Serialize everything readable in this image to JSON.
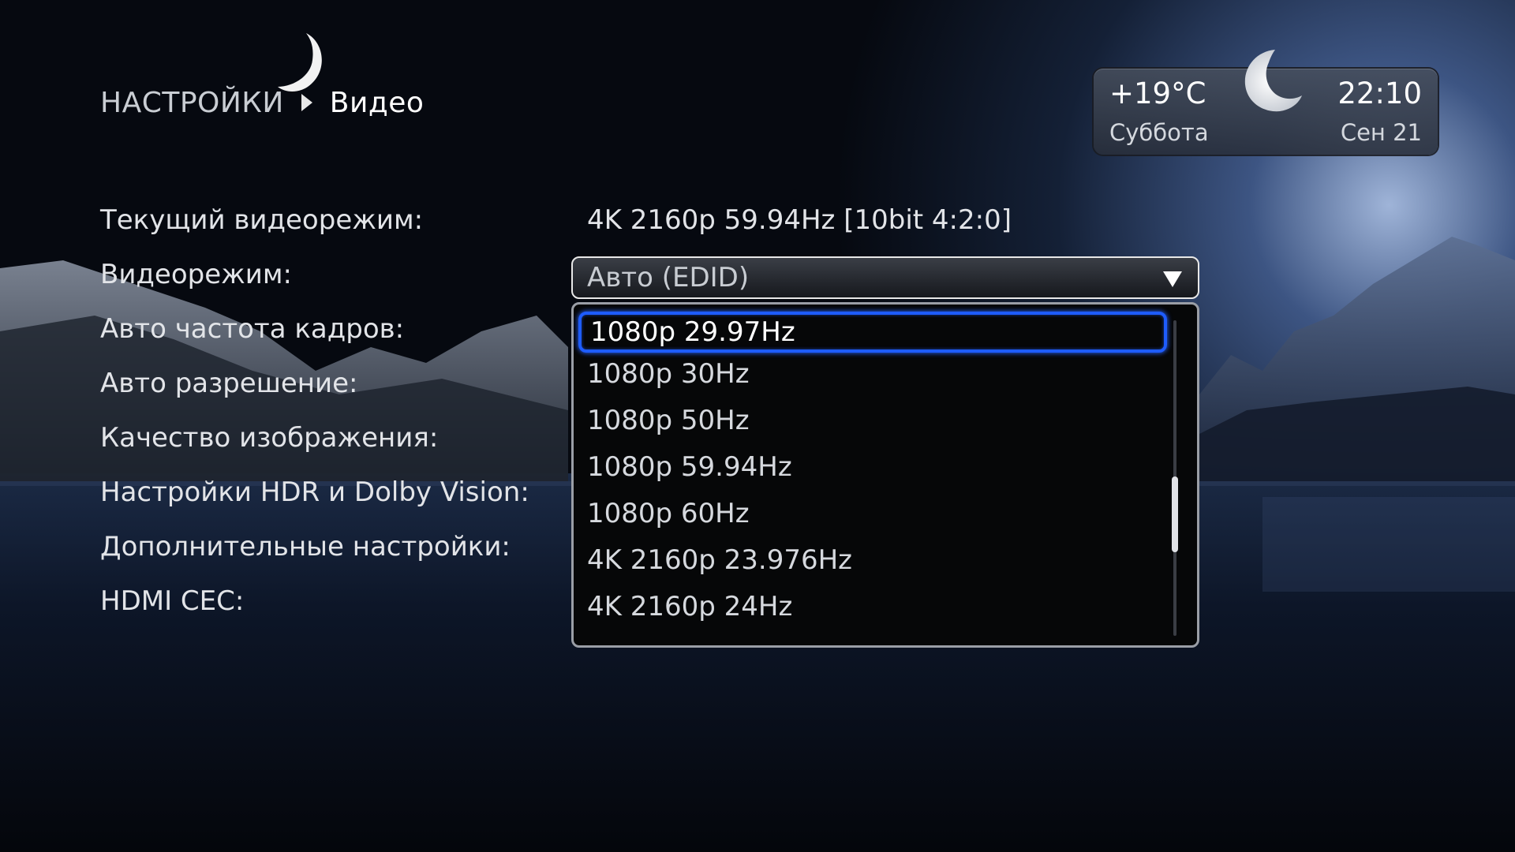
{
  "breadcrumb": {
    "root": "НАСТРОЙКИ",
    "current": "Видео"
  },
  "weather": {
    "temperature": "+19°C",
    "time": "22:10",
    "day": "Суббота",
    "date": "Сен 21",
    "icon": "crescent-moon-icon"
  },
  "settings": {
    "current_mode_label": "Текущий видеорежим:",
    "current_mode_value": "4K 2160p 59.94Hz [10bit 4:2:0]",
    "items": [
      "Видеорежим:",
      "Авто частота кадров:",
      "Авто разрешение:",
      "Качество изображения:",
      "Настройки HDR и Dolby Vision:",
      "Дополнительные настройки:",
      "HDMI CEC:"
    ]
  },
  "video_mode_select": {
    "value": "Авто (EDID)",
    "options": [
      "1080p 29.97Hz",
      "1080p 30Hz",
      "1080p 50Hz",
      "1080p 59.94Hz",
      "1080p 60Hz",
      "4K 2160p 23.976Hz",
      "4K 2160p 24Hz"
    ],
    "selected_index": 0
  },
  "colors": {
    "focus_accent": "#1e5cff",
    "background": "#05070b"
  }
}
